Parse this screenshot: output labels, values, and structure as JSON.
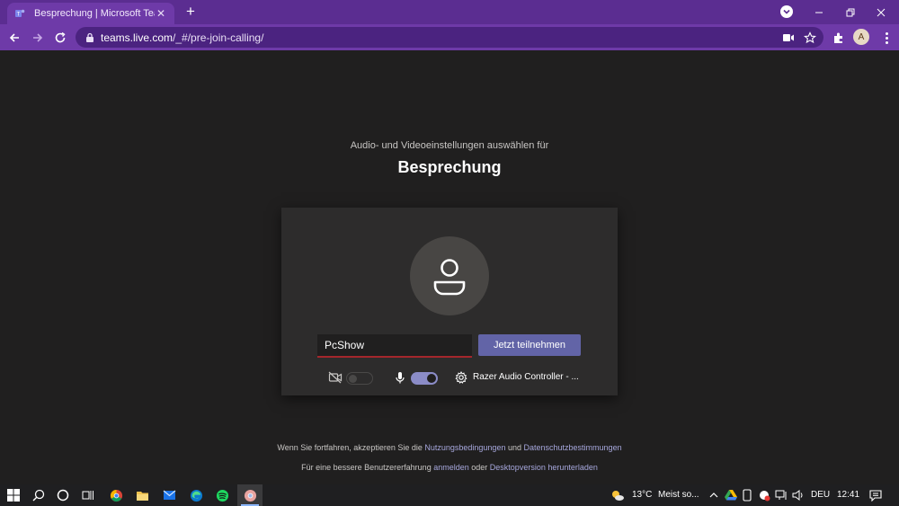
{
  "browser": {
    "tab": {
      "title": "Besprechung | Microsoft Teams"
    },
    "url": {
      "host": "teams.live.com",
      "path": "/_#/pre-join-calling/"
    },
    "profile_initial": "A"
  },
  "prejoin": {
    "subtitle": "Audio- und Videoeinstellungen auswählen für",
    "title": "Besprechung",
    "name_value": "PcShow",
    "join_label": "Jetzt teilnehmen",
    "camera_on": false,
    "mic_on": true,
    "audio_device": "Razer Audio Controller - ..."
  },
  "footer": {
    "terms_prefix": "Wenn Sie fortfahren, akzeptieren Sie die",
    "terms_link": "Nutzungsbedingungen",
    "terms_and": "und",
    "privacy_link": "Datenschutzbestimmungen",
    "better_prefix": "Für eine bessere Benutzererfahrung",
    "signin_link": "anmelden",
    "or": "oder",
    "desktop_link": "Desktopversion herunterladen"
  },
  "taskbar": {
    "weather": "13°C",
    "weather_desc": "Meist so...",
    "language": "DEU",
    "time": "12:41"
  },
  "colors": {
    "accent": "#6264a7",
    "chrome_tab": "#5b2d91",
    "chrome_toolbar": "#6e3aa8",
    "background": "#201f1f",
    "card": "#2d2c2c",
    "input_underline": "#a4262c"
  }
}
